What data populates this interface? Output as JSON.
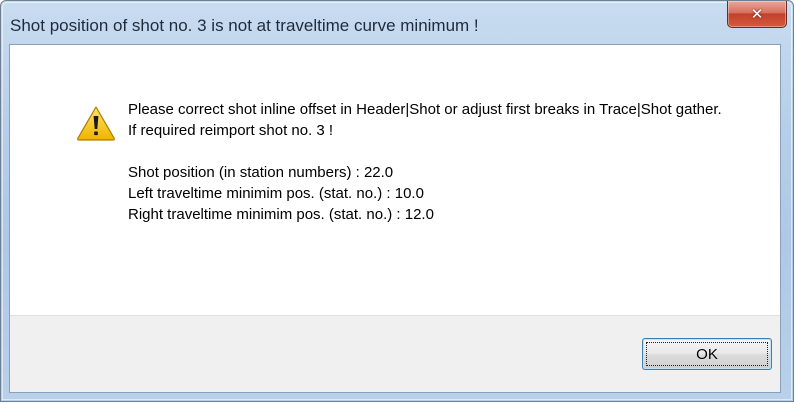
{
  "window": {
    "title": "Shot position of shot no. 3 is not at traveltime curve minimum !"
  },
  "titlebar": {
    "close_icon": "close-icon",
    "close_glyph": "✕"
  },
  "message": {
    "icon": "warning-icon",
    "line1": "Please correct shot inline offset in Header|Shot or adjust first breaks in Trace|Shot gather.",
    "line2": "If required reimport shot no. 3 !",
    "line3": "Shot position (in station numbers) : 22.0",
    "line4": "Left traveltime minimim pos. (stat. no.) : 10.0",
    "line5": "Right traveltime minimim pos. (stat. no.) : 12.0"
  },
  "buttons": {
    "ok_label": "OK"
  },
  "colors": {
    "close_button": "#c2412c",
    "footer": "#f0f0f0",
    "warning_yellow": "#f5c400"
  }
}
